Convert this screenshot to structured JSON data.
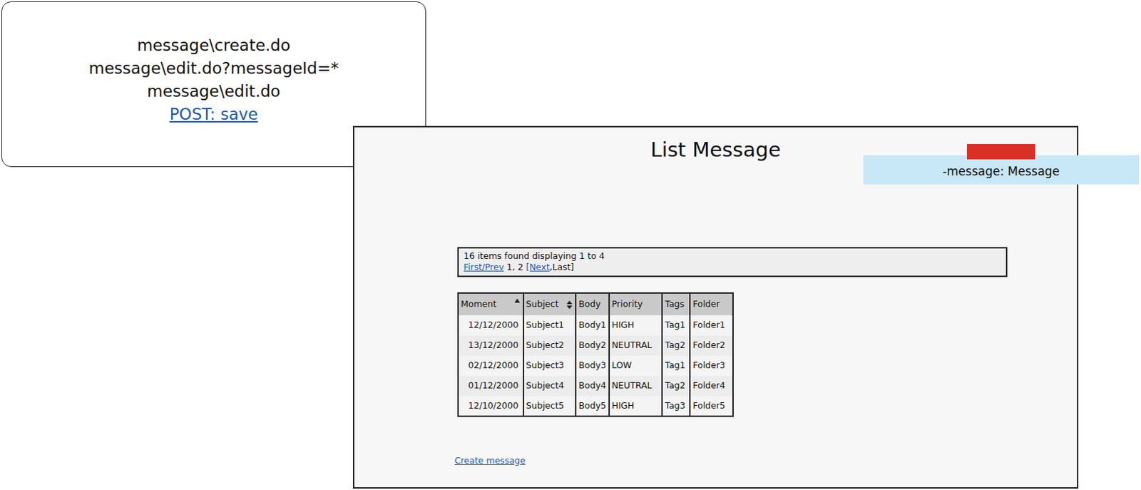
{
  "callout": {
    "lines": [
      "message\\create.do",
      "message\\edit.do?messageId=*",
      "message\\edit.do"
    ],
    "link": "POST: save"
  },
  "window": {
    "title": "List Message"
  },
  "note": {
    "text": "-message: Message"
  },
  "pagination": {
    "summary": "16 items found displaying 1 to 4",
    "parts": [
      {
        "text": "First/Prev",
        "link": true
      },
      {
        "text": " 1, 2 ",
        "link": false
      },
      {
        "text": "[Next",
        "link": true
      },
      {
        "text": ",Last]",
        "link": false
      }
    ]
  },
  "table": {
    "columns": [
      {
        "label": "Moment",
        "sort": "asc"
      },
      {
        "label": "Subject",
        "sort": "both"
      },
      {
        "label": "Body",
        "sort": "none"
      },
      {
        "label": "Priority",
        "sort": "none"
      },
      {
        "label": "Tags",
        "sort": "none"
      },
      {
        "label": "Folder",
        "sort": "none"
      }
    ],
    "rows": [
      [
        "12/12/2000",
        "Subject1",
        "Body1",
        "HIGH",
        "Tag1",
        "Folder1"
      ],
      [
        "13/12/2000",
        "Subject2",
        "Body2",
        "NEUTRAL",
        "Tag2",
        "Folder2"
      ],
      [
        "02/12/2000",
        "Subject3",
        "Body3",
        "LOW",
        "Tag1",
        "Folder3"
      ],
      [
        "01/12/2000",
        "Subject4",
        "Body4",
        "NEUTRAL",
        "Tag2",
        "Folder4"
      ],
      [
        "12/10/2000",
        "Subject5",
        "Body5",
        "HIGH",
        "Tag3",
        "Folder5"
      ]
    ]
  },
  "create_link": "Create message"
}
